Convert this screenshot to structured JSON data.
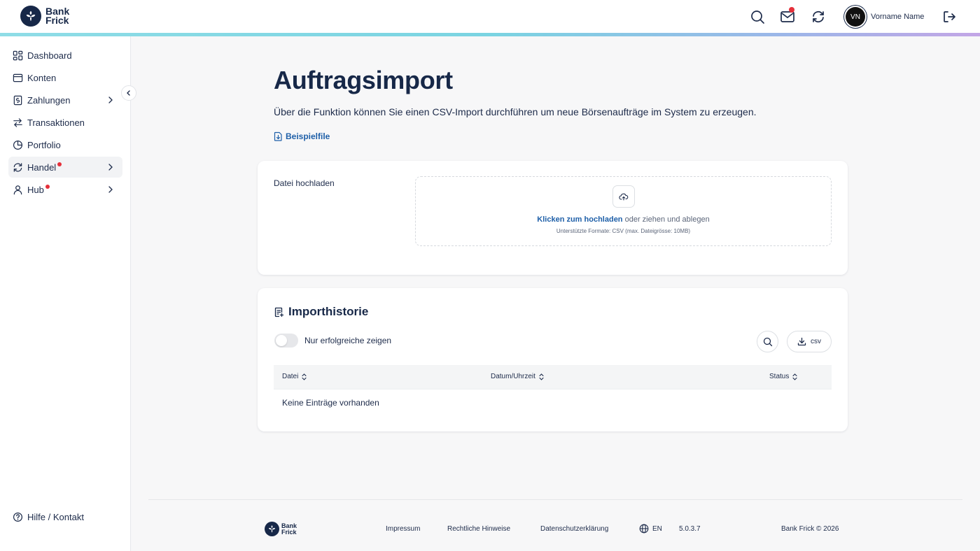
{
  "brand": {
    "line1": "Bank",
    "line2": "Frick"
  },
  "header": {
    "user_initials": "VN",
    "user_name": "Vorname Name"
  },
  "sidebar": {
    "items": [
      {
        "label": "Dashboard",
        "icon": "dashboard-icon"
      },
      {
        "label": "Konten",
        "icon": "wallet-icon"
      },
      {
        "label": "Zahlungen",
        "icon": "payment-icon"
      },
      {
        "label": "Transaktionen",
        "icon": "transfer-arrows-icon"
      },
      {
        "label": "Portfolio",
        "icon": "pie-chart-icon"
      },
      {
        "label": "Handel",
        "icon": "refresh-icon"
      },
      {
        "label": "Hub",
        "icon": "user-icon"
      }
    ],
    "help": "Hilfe / Kontakt"
  },
  "main": {
    "title": "Auftragsimport",
    "description": "Über die Funktion können Sie einen CSV-Import durchführen um neue Börsenaufträge im System zu erzeugen.",
    "example_link": "Beispielfile"
  },
  "upload": {
    "label": "Datei hochladen",
    "click_text": "Klicken zum hochladen",
    "drag_text": " oder ziehen und ablegen",
    "formats": "Unterstützte Formate: CSV (max. Dateigrösse: 10MB)"
  },
  "history": {
    "title": "Importhistorie",
    "toggle_label": "Nur erfolgreiche zeigen",
    "csv_label": "csv",
    "columns": [
      "Datei",
      "Datum/Uhrzeit",
      "Status"
    ],
    "empty": "Keine Einträge vorhanden"
  },
  "footer": {
    "links": [
      "Impressum",
      "Rechtliche Hinweise",
      "Datenschutzerklärung"
    ],
    "language": "EN",
    "version": "5.0.3.7",
    "copyright": "Bank Frick © 2026"
  },
  "colors": {
    "navy": "#172848",
    "link": "#1e5fa8",
    "badge": "#e5303a"
  }
}
